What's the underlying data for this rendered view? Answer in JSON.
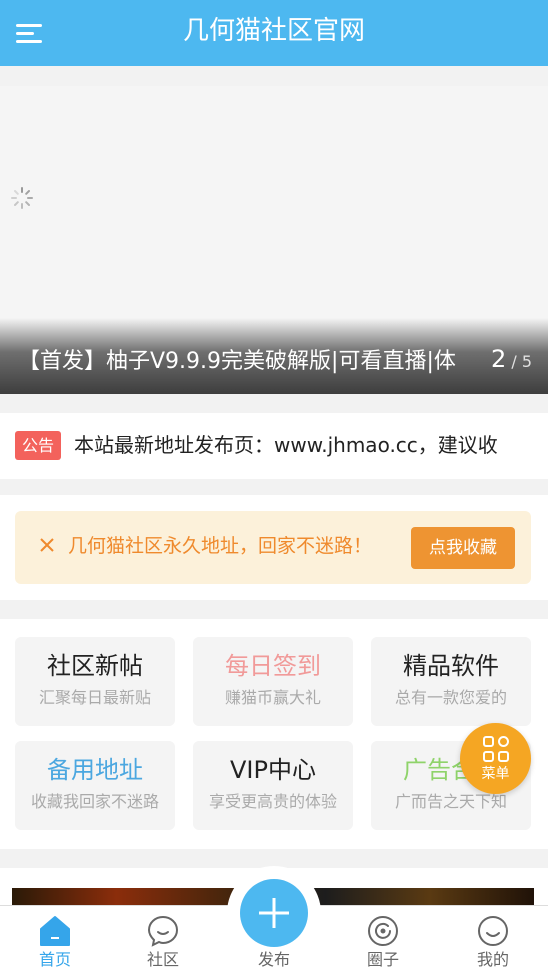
{
  "header": {
    "title": "几何猫社区官网",
    "menu_icon": "hamburger-menu-icon"
  },
  "banner": {
    "title": "【首发】柚子V9.9.9完美破解版|可看直播|体",
    "current_page": "2",
    "page_total": " / 5",
    "loading_icon": "loading-spinner-icon"
  },
  "notice": {
    "badge": "公告",
    "text": "本站最新地址发布页：www.jhmao.cc，建议收"
  },
  "address_card": {
    "text": "几何猫社区永久地址，回家不迷路！",
    "button": "点我收藏",
    "close_icon": "close-icon",
    "text_color": "#ef8a2d",
    "button_color": "#ee9432"
  },
  "grid": {
    "tiles": [
      {
        "title": "社区新帖",
        "subtitle": "汇聚每日最新贴",
        "color": "#222222"
      },
      {
        "title": "每日签到",
        "subtitle": "赚猫币赢大礼",
        "color": "#f19a99"
      },
      {
        "title": "精品软件",
        "subtitle": "总有一款您爱的",
        "color": "#222222"
      },
      {
        "title": "备用地址",
        "subtitle": "收藏我回家不迷路",
        "color": "#4ba7e0"
      },
      {
        "title": "VIP中心",
        "subtitle": "享受更高贵的体验",
        "color": "#222222"
      },
      {
        "title": "广告合作",
        "subtitle": "广而告之天下知",
        "color": "#8fd36a"
      }
    ]
  },
  "fab": {
    "label": "菜单",
    "icon": "apps-grid-icon",
    "color": "#f5a623"
  },
  "tabbar": {
    "tabs": [
      {
        "label": "首页",
        "icon": "home-icon",
        "active": true
      },
      {
        "label": "社区",
        "icon": "chat-bubble-icon",
        "active": false
      },
      {
        "label": "发布",
        "icon": "plus-icon",
        "active": false
      },
      {
        "label": "圈子",
        "icon": "circle-icon",
        "active": false
      },
      {
        "label": "我的",
        "icon": "smiley-face-icon",
        "active": false
      }
    ],
    "accent_color": "#35a5ea"
  },
  "theme": {
    "header_color": "#4db8f0",
    "notice_badge_color": "#f3625c"
  }
}
